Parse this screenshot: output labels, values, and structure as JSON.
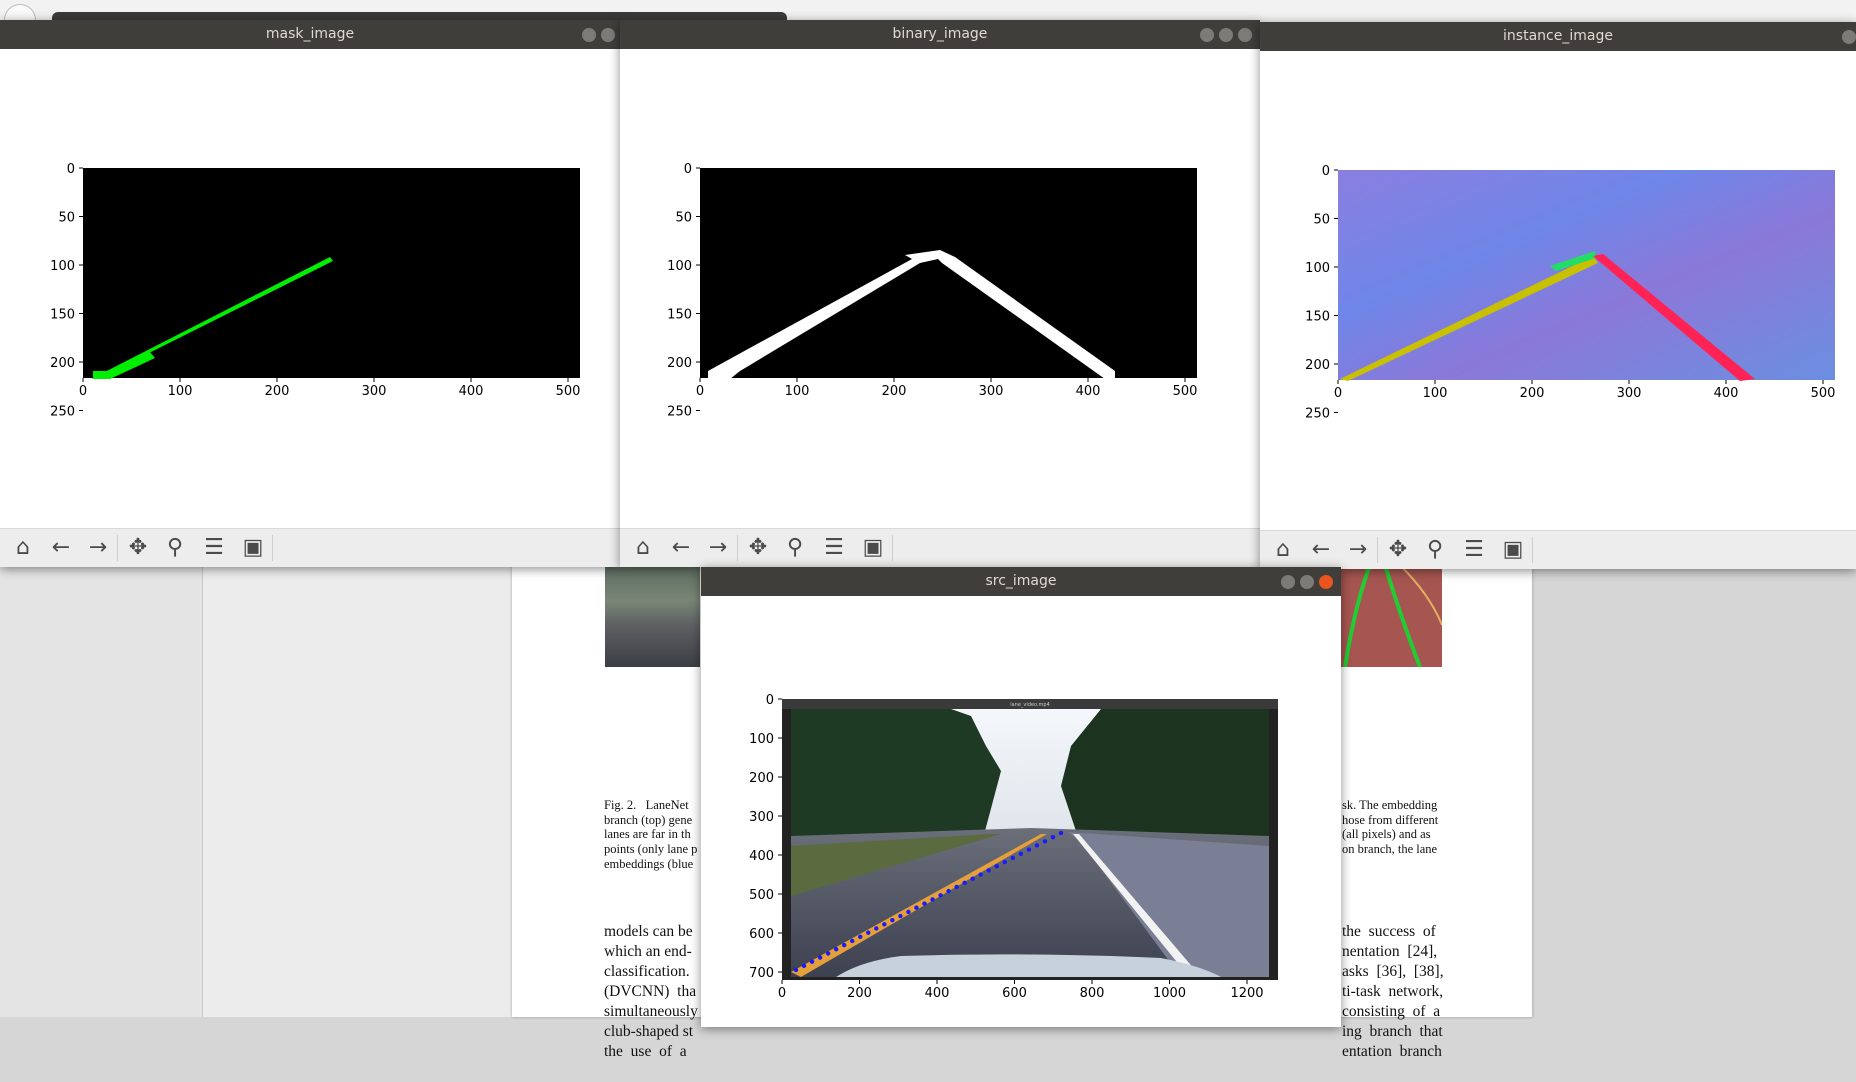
{
  "windows": {
    "mask": {
      "title": "mask_image"
    },
    "binary": {
      "title": "binary_image"
    },
    "instance": {
      "title": "instance_image"
    },
    "src": {
      "title": "src_image",
      "embedded_title": "lane_video.mp4"
    }
  },
  "toolbar": {
    "icons": [
      "home-icon",
      "back-arrow-icon",
      "forward-arrow-icon",
      "pan-icon",
      "zoom-icon",
      "configure-subplots-icon",
      "save-icon"
    ]
  },
  "axes": {
    "small_x_ticks": [
      "0",
      "100",
      "200",
      "300",
      "400",
      "500"
    ],
    "small_y_ticks": [
      "0",
      "50",
      "100",
      "150",
      "200",
      "250"
    ],
    "src_x_ticks": [
      "0",
      "200",
      "400",
      "600",
      "800",
      "1000",
      "1200"
    ],
    "src_y_ticks": [
      "0",
      "100",
      "200",
      "300",
      "400",
      "500",
      "600",
      "700"
    ]
  },
  "colors": {
    "titlebar": "#3f3e3b",
    "mask_lane": "#00ee00",
    "binary_lane": "#ffffff",
    "instance_left_lane": "#c8c000",
    "instance_right_lane": "#ff2255",
    "src_lane_fit": "#1a1aff",
    "src_lane_paint": "#e6a03a"
  },
  "document": {
    "caption_left": [
      "Fig. 2.   LaneNet",
      "branch (top) gene",
      "lanes are far in th",
      "points (only lane p",
      "embeddings (blue"
    ],
    "caption_right": [
      "sk. The embedding",
      "hose from different",
      "(all pixels) and as",
      "on branch, the lane"
    ],
    "body_left": [
      "models can be",
      "which an end-",
      "classification.",
      "(DVCNN)  tha",
      "simultaneously",
      "club-shaped st",
      "the  use  of  a"
    ],
    "body_right": [
      "the  success  of",
      "nentation  [24],",
      "asks  [36],  [38],",
      "ti-task  network,",
      "consisting  of  a",
      "ing  branch  that",
      "entation  branch"
    ]
  }
}
